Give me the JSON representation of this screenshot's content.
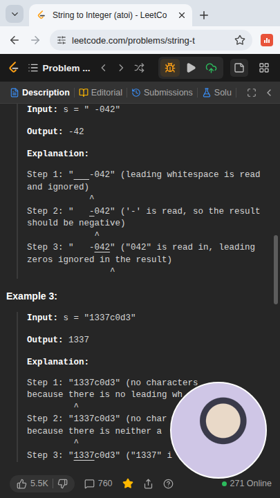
{
  "browser": {
    "tab_title": "String to Integer (atoi) - LeetCo",
    "url": "leetcode.com/problems/string-t"
  },
  "nav": {
    "title": "Problem ..."
  },
  "tabs": [
    {
      "label": "Description",
      "selected": true
    },
    {
      "label": "Editorial",
      "selected": false
    },
    {
      "label": "Submissions",
      "selected": false
    },
    {
      "label": "Solu",
      "selected": false
    }
  ],
  "examples": [
    {
      "input_label": "Input:",
      "input": "s = \" -042\"",
      "output_label": "Output:",
      "output": "-42",
      "explanation_label": "Explanation:",
      "steps": [
        {
          "label": "Step 1:",
          "parts": [
            {
              "text": "\"",
              "mark": false
            },
            {
              "text": "   ",
              "mark": true
            },
            {
              "text": "-042\"",
              "mark": false
            }
          ],
          "note": " (leading whitespace is read\nand ignored)",
          "caret": "            ^"
        },
        {
          "label": "Step 2:",
          "parts": [
            {
              "text": "\"   ",
              "mark": false
            },
            {
              "text": "-",
              "mark": true
            },
            {
              "text": "042\"",
              "mark": false
            }
          ],
          "note": " ('-' is read, so the result\nshould be negative)",
          "caret": "             ^"
        },
        {
          "label": "Step 3:",
          "parts": [
            {
              "text": "\"   -",
              "mark": false
            },
            {
              "text": "042",
              "mark": true
            },
            {
              "text": "\"",
              "mark": false
            }
          ],
          "note": " (\"042\" is read in, leading\nzeros ignored in the result)",
          "caret": "                ^"
        }
      ]
    },
    {
      "heading": "Example 3:",
      "input_label": "Input:",
      "input": "s = \"1337c0d3\"",
      "output_label": "Output:",
      "output": "1337",
      "explanation_label": "Explanation:",
      "steps": [
        {
          "label": "Step 1:",
          "parts": [
            {
              "text": "\"1337c0d3\"",
              "mark": false
            }
          ],
          "note": " (no characters\nbecause there is no leading wh",
          "caret": "         ^"
        },
        {
          "label": "Step 2:",
          "parts": [
            {
              "text": "\"1337c0d3\"",
              "mark": false
            }
          ],
          "note": " (no char\nbecause there is neither a",
          "caret": "         ^"
        },
        {
          "label": "Step 3:",
          "parts": [
            {
              "text": "\"",
              "mark": false
            },
            {
              "text": "1337",
              "mark": true
            },
            {
              "text": "c0d3\"",
              "mark": false
            }
          ],
          "note": " (\"1337\" i",
          "caret": ""
        }
      ]
    }
  ],
  "footer": {
    "likes": "5.5K",
    "comments": "760",
    "favorited": true,
    "online": "271 Online"
  }
}
